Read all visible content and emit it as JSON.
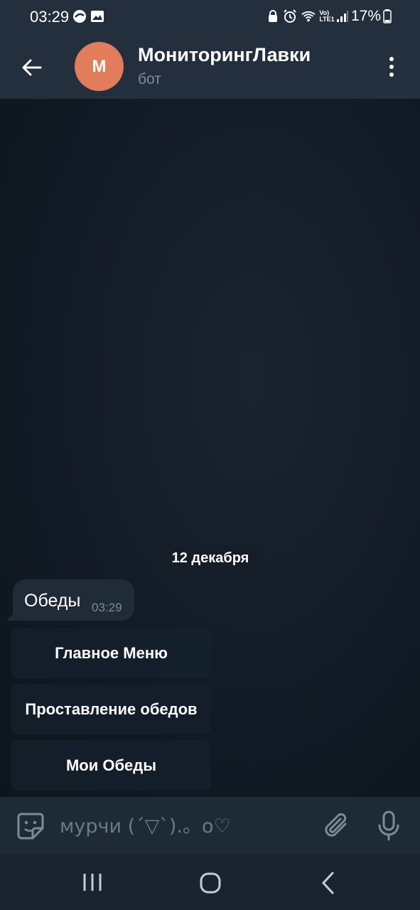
{
  "status_bar": {
    "time": "03:29",
    "battery": "17%"
  },
  "header": {
    "avatar_letter": "M",
    "title": "МониторингЛавки",
    "subtitle": "бот"
  },
  "chat": {
    "date_label": "12 декабря",
    "message": {
      "text": "Обеды",
      "time": "03:29"
    },
    "keyboard_buttons": [
      {
        "label": "Главное Меню"
      },
      {
        "label": "Проставление обедов"
      },
      {
        "label": "Мои Обеды"
      }
    ]
  },
  "input": {
    "placeholder": "мурчи (´▽`).。o♡"
  },
  "colors": {
    "avatar": "#e17d5a",
    "header_bg": "#242f3d",
    "bubble_bg": "#1f2b37"
  }
}
